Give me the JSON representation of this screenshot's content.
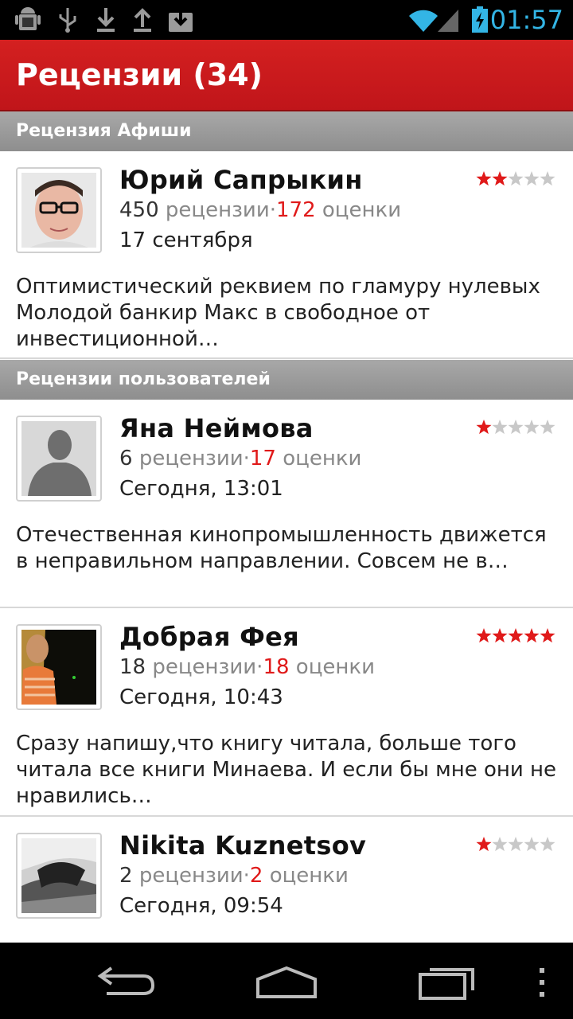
{
  "status_bar": {
    "time": "01:57",
    "icons": [
      "android-debug-icon",
      "usb-icon",
      "download-icon",
      "upload-icon",
      "download-box-icon",
      "wifi-icon",
      "signal-icon",
      "battery-charging-icon"
    ]
  },
  "action_bar": {
    "title": "Рецензии (34)"
  },
  "sections": {
    "afisha": "Рецензия Афиши",
    "users": "Рецензии пользователей"
  },
  "reviews": [
    {
      "name": "Юрий Сапрыкин",
      "reviews_count": "450",
      "reviews_word": "рецензии",
      "ratings_count": "172",
      "ratings_word": "оценки",
      "date": "17 сентября",
      "rating": 2,
      "text": "Оптимистический реквием по гламуру нулевых Молодой банкир Макс в свободное от инвестиционной…"
    },
    {
      "name": "Яна Неймова",
      "reviews_count": "6",
      "reviews_word": "рецензии",
      "ratings_count": "17",
      "ratings_word": "оценки",
      "date": "Сегодня, 13:01",
      "rating": 1,
      "text": "Отечественная кинопромышленность движется в неправильном направлении. Совсем не в…"
    },
    {
      "name": "Добрая Фея",
      "reviews_count": "18",
      "reviews_word": "рецензии",
      "ratings_count": "18",
      "ratings_word": "оценки",
      "date": "Сегодня, 10:43",
      "rating": 5,
      "text": "Сразу напишу,что книгу читала, больше того читала все книги Минаева. И если бы мне они не нравились…"
    },
    {
      "name": "Nikita Kuznetsov",
      "reviews_count": "2",
      "reviews_word": "рецензии",
      "ratings_count": "2",
      "ratings_word": "оценки",
      "date": "Сегодня, 09:54",
      "rating": 1,
      "text": ""
    }
  ],
  "colors": {
    "accent_red": "#d42020",
    "count_red": "#e01a1a",
    "section_gray": "#9a9a9a",
    "status_blue": "#33b5e5"
  },
  "nav_bar": {
    "icons": [
      "back-icon",
      "home-icon",
      "recent-apps-icon",
      "overflow-menu-icon"
    ]
  }
}
